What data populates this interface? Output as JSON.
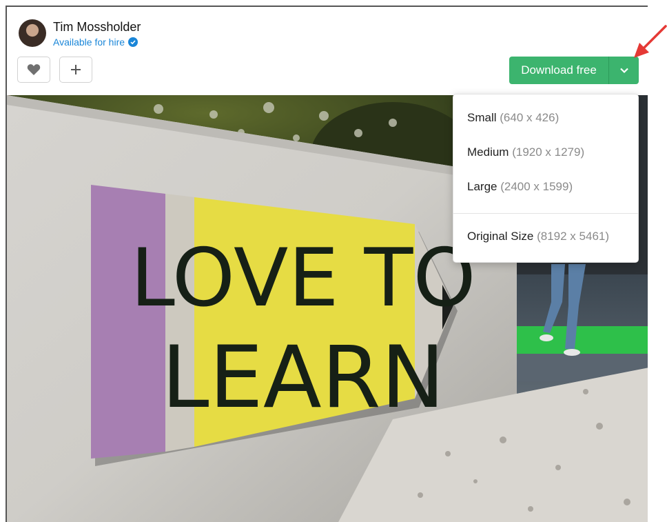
{
  "author": {
    "name": "Tim Mossholder",
    "status": "Available for hire"
  },
  "actions": {
    "like_icon": "heart-icon",
    "collect_icon": "plus-icon"
  },
  "download": {
    "label": "Download free",
    "caret_icon": "chevron-down-icon"
  },
  "menu": {
    "items": [
      {
        "label": "Small",
        "size": "(640 x 426)"
      },
      {
        "label": "Medium",
        "size": "(1920 x 1279)"
      },
      {
        "label": "Large",
        "size": "(2400 x 1599)"
      },
      {
        "label": "Original Size",
        "size": "(8192 x 5461)"
      }
    ]
  },
  "photo": {
    "text_line1": "LOVE TO",
    "text_line2": "LEARN"
  },
  "colors": {
    "accent_green": "#3cb46e",
    "link_blue": "#1a86d8",
    "annotation_red": "#e53935"
  }
}
